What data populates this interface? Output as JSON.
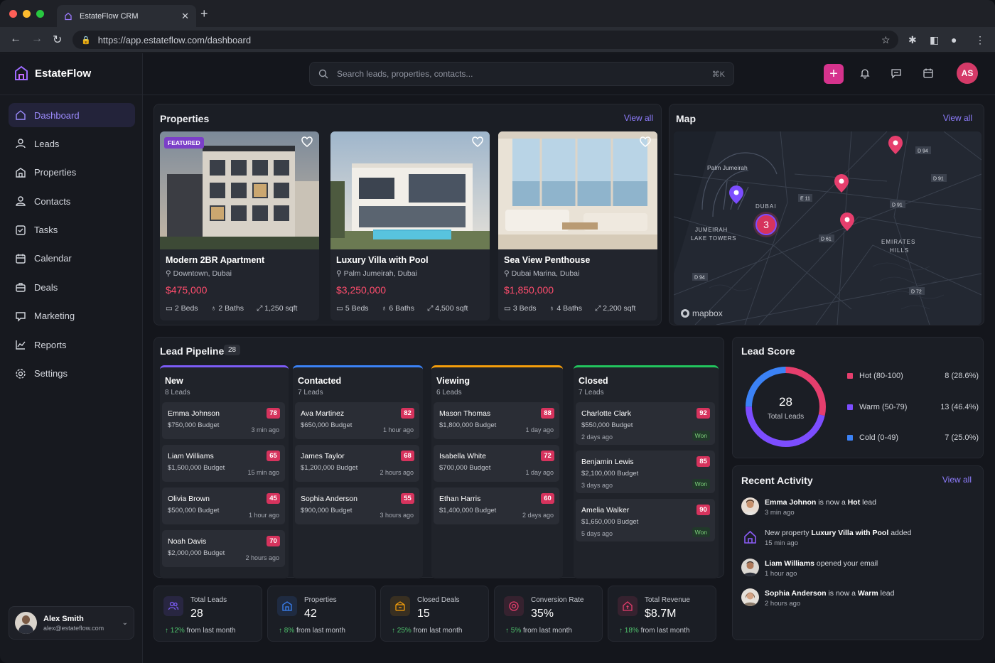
{
  "browser": {
    "tab_title": "EstateFlow CRM",
    "url": "https://app.estateflow.com/dashboard",
    "colors": {
      "close": "#ff5f57",
      "minimize": "#febc2e",
      "zoom": "#28c840"
    }
  },
  "brand": {
    "name": "EstateFlow",
    "accent": "#8b5cf6"
  },
  "sidebar": {
    "items": [
      {
        "label": "Dashboard",
        "icon": "home-icon",
        "active": true
      },
      {
        "label": "Leads",
        "icon": "user-icon"
      },
      {
        "label": "Properties",
        "icon": "building-icon"
      },
      {
        "label": "Contacts",
        "icon": "contact-icon"
      },
      {
        "label": "Tasks",
        "icon": "checkbox-icon"
      },
      {
        "label": "Calendar",
        "icon": "calendar-icon"
      },
      {
        "label": "Deals",
        "icon": "briefcase-icon"
      },
      {
        "label": "Marketing",
        "icon": "megaphone-icon"
      },
      {
        "label": "Reports",
        "icon": "chart-icon"
      },
      {
        "label": "Settings",
        "icon": "gear-icon"
      }
    ],
    "user": {
      "name": "Alex Smith",
      "email": "alex@estateflow.com"
    }
  },
  "topbar": {
    "search_placeholder": "Search leads, properties, contacts...",
    "search_shortcut": "⌘K",
    "profile_initials": "AS"
  },
  "properties": {
    "title": "Properties",
    "view_all": "View all",
    "featured_label": "FEATURED",
    "items": [
      {
        "name": "Modern 2BR Apartment",
        "location": "Downtown, Dubai",
        "price": "$475,000",
        "beds": "2 Beds",
        "baths": "2 Baths",
        "area": "1,250 sqft"
      },
      {
        "name": "Luxury Villa with Pool",
        "location": "Palm Jumeirah, Dubai",
        "price": "$3,250,000",
        "beds": "5 Beds",
        "baths": "6 Baths",
        "area": "4,500 sqft"
      },
      {
        "name": "Sea View Penthouse",
        "location": "Dubai Marina, Dubai",
        "price": "$1,850,000",
        "beds": "3 Beds",
        "baths": "4 Baths",
        "area": "2,200 sqft"
      }
    ]
  },
  "map": {
    "title": "Map",
    "view_all": "View all",
    "labels": {
      "palm": "Palm Jumeirah",
      "dubai": "DUBAI",
      "jlt_1": "JUMEIRAH",
      "jlt_2": "LAKE TOWERS",
      "hills_1": "EMIRATES",
      "hills_2": "HILLS",
      "road_e11": "E 11",
      "road_d94a": "D 94",
      "road_d94b": "D 94",
      "road_d91a": "D 91",
      "road_d91b": "D 91",
      "road_d61": "D 61",
      "road_d72": "D 72",
      "cluster": "3",
      "attribution": "mapbox"
    }
  },
  "pipeline": {
    "title": "Lead Pipeline",
    "total": "28",
    "columns": [
      {
        "title": "New",
        "count": "8 Leads",
        "color": "#7c5cf6",
        "leads": [
          {
            "name": "Emma Johnson",
            "budget": "$750,000 Budget",
            "time": "3 min ago",
            "score": "78"
          },
          {
            "name": "Liam Williams",
            "budget": "$1,500,000 Budget",
            "time": "15 min ago",
            "score": "65"
          },
          {
            "name": "Olivia Brown",
            "budget": "$500,000 Budget",
            "time": "1 hour ago",
            "score": "45"
          },
          {
            "name": "Noah Davis",
            "budget": "$2,000,000 Budget",
            "time": "2 hours ago",
            "score": "70"
          }
        ]
      },
      {
        "title": "Contacted",
        "count": "7 Leads",
        "color": "#3b82f6",
        "leads": [
          {
            "name": "Ava Martinez",
            "budget": "$650,000 Budget",
            "time": "1 hour ago",
            "score": "82"
          },
          {
            "name": "James Taylor",
            "budget": "$1,200,000 Budget",
            "time": "2 hours ago",
            "score": "68"
          },
          {
            "name": "Sophia Anderson",
            "budget": "$900,000 Budget",
            "time": "3 hours ago",
            "score": "55"
          }
        ]
      },
      {
        "title": "Viewing",
        "count": "6 Leads",
        "color": "#f59e0b",
        "leads": [
          {
            "name": "Mason Thomas",
            "budget": "$1,800,000 Budget",
            "time": "1 day ago",
            "score": "88"
          },
          {
            "name": "Isabella White",
            "budget": "$700,000 Budget",
            "time": "1 day ago",
            "score": "72"
          },
          {
            "name": "Ethan Harris",
            "budget": "$1,400,000 Budget",
            "time": "2 days ago",
            "score": "60"
          }
        ]
      },
      {
        "title": "Closed",
        "count": "7 Leads",
        "color": "#22c55e",
        "leads": [
          {
            "name": "Charlotte Clark",
            "budget": "$550,000 Budget",
            "time": "2 days ago",
            "score": "92",
            "status": "Won"
          },
          {
            "name": "Benjamin Lewis",
            "budget": "$2,100,000 Budget",
            "time": "3 days ago",
            "score": "85",
            "status": "Won"
          },
          {
            "name": "Amelia Walker",
            "budget": "$1,650,000 Budget",
            "time": "5 days ago",
            "score": "90",
            "status": "Won"
          }
        ]
      }
    ]
  },
  "lead_score": {
    "title": "Lead Score",
    "total": "28",
    "total_label": "Total Leads",
    "segments": [
      {
        "label": "Hot (80-100)",
        "value": "8 (28.6%)",
        "count": 8,
        "color": "#e63e6d"
      },
      {
        "label": "Warm (50-79)",
        "value": "13 (46.4%)",
        "count": 13,
        "color": "#7c4dff"
      },
      {
        "label": "Cold (0-49)",
        "value": "7 (25.0%)",
        "count": 7,
        "color": "#3b82f6"
      }
    ]
  },
  "activity": {
    "title": "Recent Activity",
    "view_all": "View all",
    "items": [
      {
        "pre": "Emma Johnon",
        "mid": " is now a ",
        "post": "Hot",
        "tail": " lead",
        "time": "3 min ago"
      },
      {
        "pre": "New property ",
        "mid": "Luxury Villa with Pool",
        "post": " added",
        "tail": "",
        "time": "15 min ago"
      },
      {
        "pre": "Liam Williams",
        "mid": " opened your email",
        "post": "",
        "tail": "",
        "time": "1 hour ago"
      },
      {
        "pre": "Sophia Anderson",
        "mid": " is now a ",
        "post": "Warm",
        "tail": " lead",
        "time": "2 hours ago"
      }
    ]
  },
  "kpis": [
    {
      "label": "Total Leads",
      "value": "28",
      "trend": "12%",
      "trend_text": " from last month",
      "color": "#7c5cf6",
      "icon": "users-icon"
    },
    {
      "label": "Properties",
      "value": "42",
      "trend": "8%",
      "trend_text": " from last month",
      "color": "#3b82f6",
      "icon": "building-icon"
    },
    {
      "label": "Closed Deals",
      "value": "15",
      "trend": "25%",
      "trend_text": " from last month",
      "color": "#f59e0b",
      "icon": "handshake-icon"
    },
    {
      "label": "Conversion Rate",
      "value": "35%",
      "trend": "5%",
      "trend_text": " from last month",
      "color": "#e63e6d",
      "icon": "target-icon"
    },
    {
      "label": "Total Revenue",
      "value": "$8.7M",
      "trend": "18%",
      "trend_text": " from last month",
      "color": "#e63e6d",
      "icon": "house-dollar-icon"
    }
  ]
}
